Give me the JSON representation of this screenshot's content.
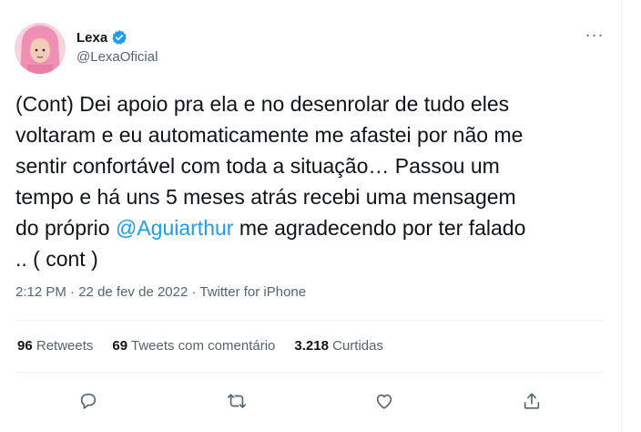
{
  "author": {
    "display_name": "Lexa",
    "handle": "@LexaOficial",
    "verified": true
  },
  "tweet": {
    "text_before_mention": "(Cont) Dei apoio pra ela e no desenrolar de tudo eles\nvoltaram e eu automaticamente me afastei por não me\nsentir confortável com toda a situação… Passou um\ntempo e há uns 5 meses atrás recebi uma mensagem\ndo próprio ",
    "mention": "@Aguiarthur",
    "text_after_mention": " me agradecendo por ter falado\n.. ( cont )"
  },
  "meta": {
    "time": "2:12 PM",
    "separator": " · ",
    "date": "22 de fev de 2022",
    "source": "Twitter for iPhone"
  },
  "stats": {
    "retweets_count": "96",
    "retweets_label": "Retweets",
    "comments_count": "69",
    "comments_label": "Tweets com comentário",
    "likes_count": "3.218",
    "likes_label": "Curtidas"
  },
  "colors": {
    "accent": "#1d9bf0",
    "text": "#0f1419",
    "secondary": "#536471",
    "divider": "#eff3f4"
  },
  "icons": {
    "more": "more-icon",
    "reply": "reply-icon",
    "retweet": "retweet-icon",
    "like": "heart-icon",
    "share": "share-icon",
    "verified": "verified-badge-icon"
  }
}
